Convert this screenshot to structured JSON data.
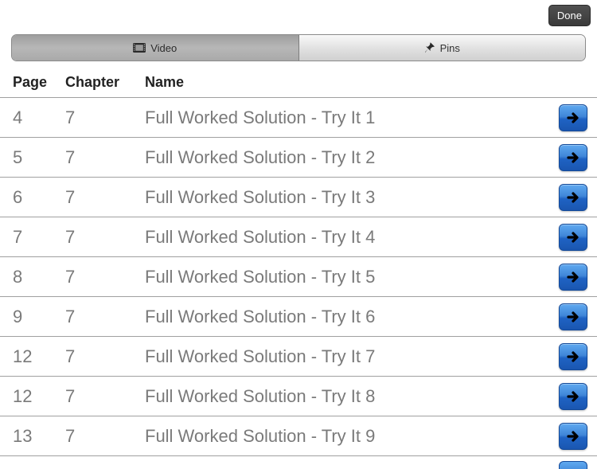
{
  "topbar": {
    "done": "Done"
  },
  "tabs": {
    "video": "Video",
    "pins": "Pins",
    "active": "video"
  },
  "columns": {
    "page": "Page",
    "chapter": "Chapter",
    "name": "Name"
  },
  "rows": [
    {
      "page": "4",
      "chapter": "7",
      "name": "Full Worked Solution - Try It 1"
    },
    {
      "page": "5",
      "chapter": "7",
      "name": "Full Worked Solution - Try It 2"
    },
    {
      "page": "6",
      "chapter": "7",
      "name": "Full Worked Solution - Try It 3"
    },
    {
      "page": "7",
      "chapter": "7",
      "name": "Full Worked Solution - Try It 4"
    },
    {
      "page": "8",
      "chapter": "7",
      "name": "Full Worked Solution - Try It 5"
    },
    {
      "page": "9",
      "chapter": "7",
      "name": "Full Worked Solution - Try It 6"
    },
    {
      "page": "12",
      "chapter": "7",
      "name": "Full Worked Solution - Try It 7"
    },
    {
      "page": "12",
      "chapter": "7",
      "name": "Full Worked Solution - Try It 8"
    },
    {
      "page": "13",
      "chapter": "7",
      "name": "Full Worked Solution - Try It 9"
    }
  ]
}
